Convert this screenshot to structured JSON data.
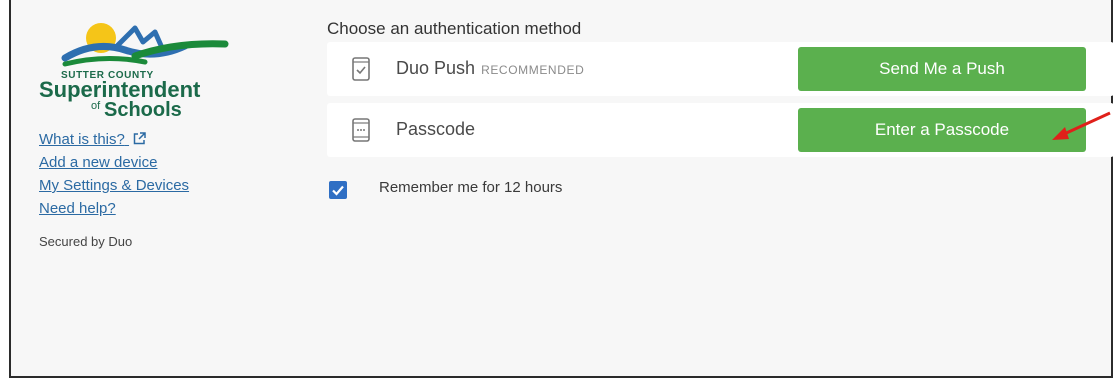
{
  "brand": {
    "small_text": "SUTTER COUNTY",
    "line1": "Superintendent",
    "of": "of",
    "line2": "Schools",
    "colors": {
      "green": "#1b6a4a",
      "sun": "#f5c518",
      "blue": "#2e6fb0"
    }
  },
  "sidebar": {
    "links": [
      {
        "label": "What is this?",
        "icon": "external-link-icon"
      },
      {
        "label": "Add a new device"
      },
      {
        "label": "My Settings & Devices"
      },
      {
        "label": "Need help?"
      }
    ],
    "secured_by": "Secured by Duo"
  },
  "main": {
    "heading": "Choose an authentication method",
    "methods": [
      {
        "label": "Duo Push",
        "badge": "RECOMMENDED",
        "icon": "phone-check-icon",
        "button": "Send Me a Push"
      },
      {
        "label": "Passcode",
        "badge": "",
        "icon": "passcode-icon",
        "button": "Enter a Passcode"
      }
    ],
    "remember": {
      "label": "Remember me for 12 hours",
      "checked": true
    },
    "button_color": "#5bb04e",
    "annotation_arrow_color": "#e0201a"
  }
}
